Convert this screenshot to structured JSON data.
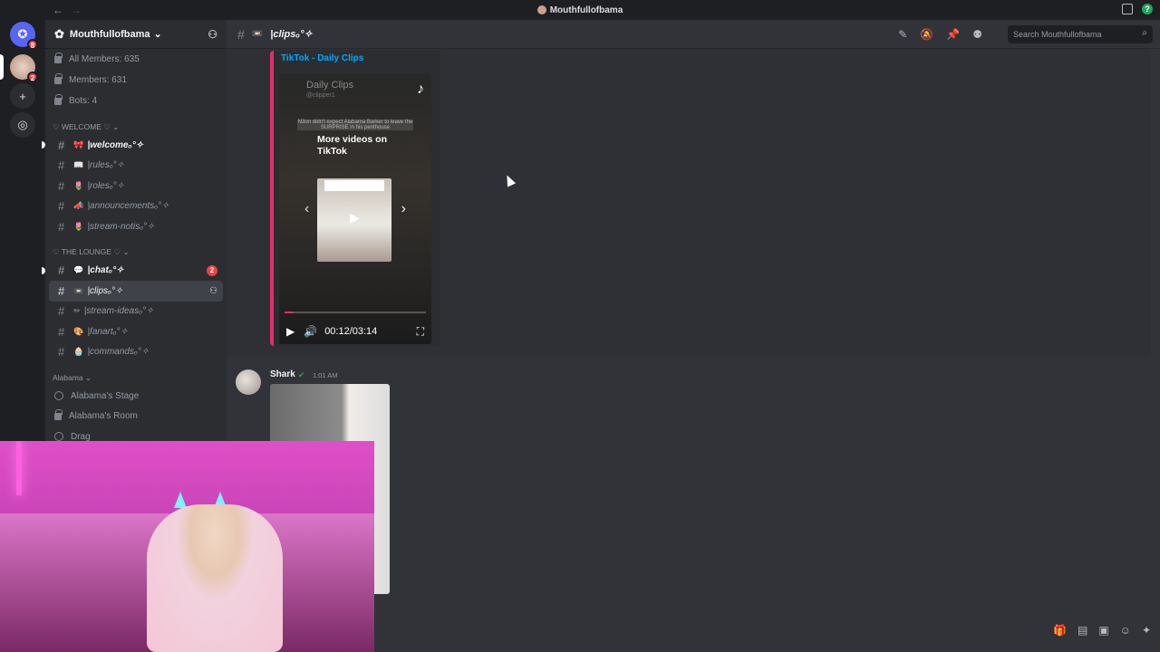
{
  "window": {
    "title": "Mouthfullofbama"
  },
  "rail": {
    "home_badge": "8",
    "server_badge": "2"
  },
  "server": {
    "name": "Mouthfullofbama"
  },
  "stats": [
    {
      "label": "All Members: 635"
    },
    {
      "label": "Members: 631"
    },
    {
      "label": "Bots: 4"
    }
  ],
  "categories": {
    "welcome": "♡ WELCOME ♡",
    "lounge": "♡ THE LOUNGE ♡",
    "alabama": "Alabama"
  },
  "channels": {
    "welcome": "|welcomeₒ°✧",
    "rules": "|rulesₒ°✧",
    "roles": "|rolesₒ°✧",
    "announcements": "|announcementsₒ°✧",
    "stream_notis": "|stream-notisₒ°✧",
    "chat": "|chatₒ°✧",
    "chat_mentions": "2",
    "clips": "|clipsₒ°✧",
    "stream_ideas": "|stream-ideasₒ°✧",
    "fanart": "|fanartₒ°✧",
    "commands": "|commandsₒ°✧"
  },
  "voice": {
    "stage": "Alabama's Stage",
    "room": "Alabama's Room",
    "drag": "Drag"
  },
  "topbar": {
    "channel": "|clipsₒ°✧",
    "search_placeholder": "Search Mouthfullofbama"
  },
  "embed": {
    "provider": "TikTok - Daily Clips",
    "tt_user": "Daily Clips",
    "tt_handle": "@clipper1",
    "caption": "N3on didn't expect Alabama Barker to leave the SURPRISE in his penthouse",
    "more_text": "More videos on TikTok",
    "time": "00:12/03:14",
    "progress": 0.064
  },
  "message2": {
    "author": "Shark",
    "time": "1:01 AM"
  }
}
